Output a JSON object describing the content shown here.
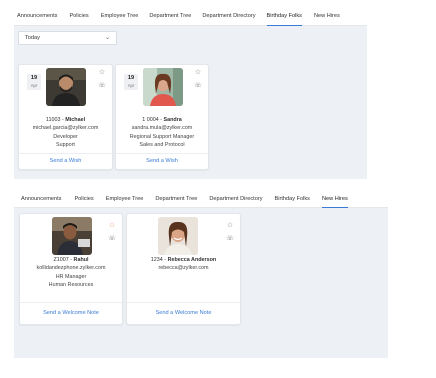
{
  "tabs": [
    "Announcements",
    "Policies",
    "Employee Tree",
    "Department Tree",
    "Department Directory",
    "Birthday Folks",
    "New Hires"
  ],
  "top": {
    "active_tab": "Birthday Folks",
    "filter": "Today",
    "cards": [
      {
        "day": "19",
        "month": "Apr",
        "id": "11003",
        "name": "Michael",
        "email": "michael.garcia@zylker.com",
        "role": "Developer",
        "dept": "Support",
        "action": "Send a Wish"
      },
      {
        "day": "19",
        "month": "Apr",
        "id": "1 0004",
        "name": "Sandra",
        "email": "sandra.mula@zylker.com",
        "role": "Regional Support Manager",
        "dept": "Sales and Protocol",
        "action": "Send a Wish"
      }
    ]
  },
  "bottom": {
    "active_tab": "New Hires",
    "cards": [
      {
        "id": "Z1007",
        "name": "Rahul",
        "email": "kollidandezphone.zylker.com",
        "role": "HR Manager",
        "dept": "Human Resources",
        "action": "Send a Welcome Note"
      },
      {
        "id": "1234",
        "name": "Rebecca Anderson",
        "email": "rebecca@zylker.com",
        "action": "Send a Welcome Note"
      }
    ]
  },
  "colors": {
    "accent": "#3a7bd5",
    "background": "#edf0f4",
    "star_active": "#e88a6a"
  },
  "icons": {
    "favorite": "star-icon",
    "call": "phone-icon",
    "dropdown": "chevron-down-icon"
  }
}
